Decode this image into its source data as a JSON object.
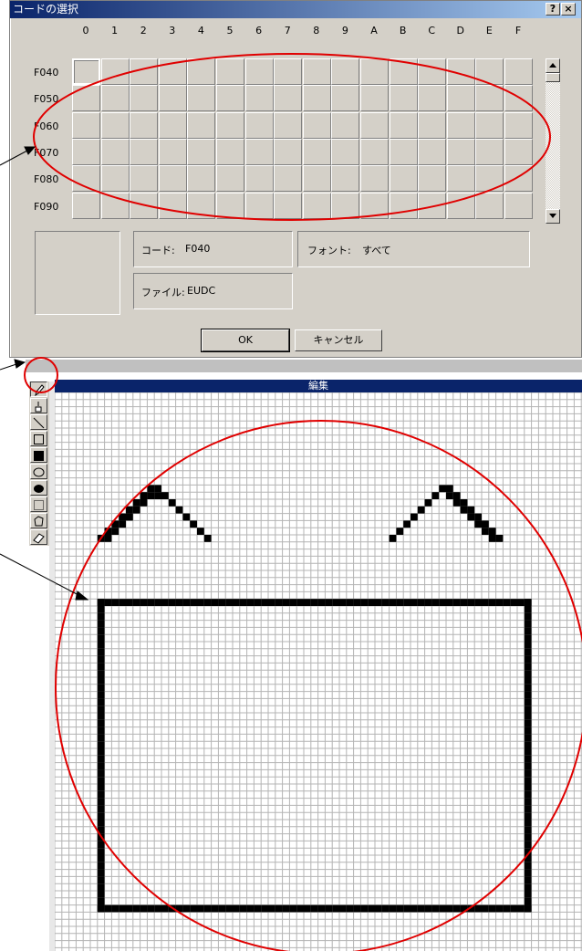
{
  "dialog": {
    "title": "コードの選択",
    "help_label": "?",
    "close_label": "×",
    "columns": [
      "0",
      "1",
      "2",
      "3",
      "4",
      "5",
      "6",
      "7",
      "8",
      "9",
      "A",
      "B",
      "C",
      "D",
      "E",
      "F"
    ],
    "rows": [
      "F040",
      "F050",
      "F060",
      "F070",
      "F080",
      "F090"
    ],
    "selected_cell": "F040",
    "code_label": "コード:",
    "code_value": "F040",
    "font_label": "フォント:",
    "font_value": "すべて",
    "file_label": "ファイル:",
    "file_value": "EUDC",
    "ok_label": "OK",
    "cancel_label": "キャンセル"
  },
  "editor": {
    "title": "編集",
    "tools": [
      "pencil-icon",
      "brush-icon",
      "line-icon",
      "hollow-rectangle-icon",
      "filled-rectangle-icon",
      "hollow-ellipse-icon",
      "filled-ellipse-icon",
      "rect-select-icon",
      "freeform-select-icon",
      "eraser-icon"
    ],
    "active_tool": "pencil-icon"
  },
  "colors": {
    "titlebar": "#0a246a",
    "annotation": "#e00000",
    "face": "#d4d0c8"
  }
}
